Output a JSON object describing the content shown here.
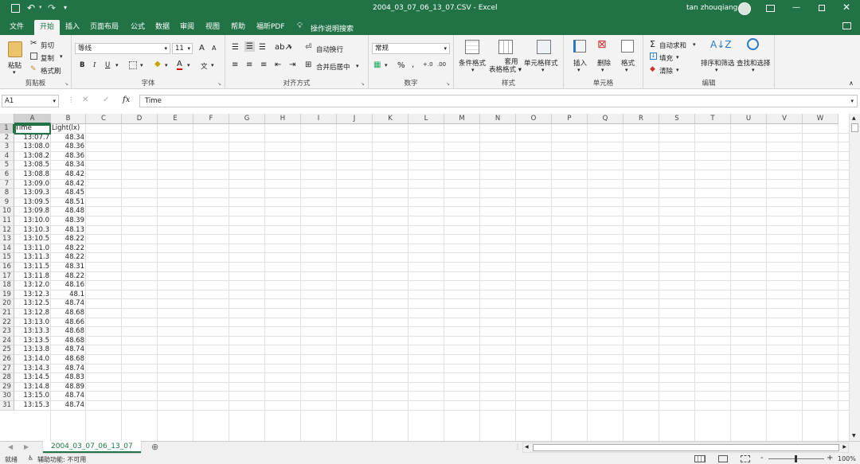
{
  "titlebar": {
    "filename": "2004_03_07_06_13_07.CSV",
    "separator": "-",
    "app": "Excel",
    "user": "tan zhouqiang"
  },
  "tabs": [
    "文件",
    "开始",
    "插入",
    "页面布局",
    "公式",
    "数据",
    "审阅",
    "视图",
    "帮助",
    "福昕PDF"
  ],
  "tell_me": "操作说明搜索",
  "ribbon": {
    "clipboard": {
      "paste": "粘贴",
      "cut": "剪切",
      "copy": "复制",
      "format_painter": "格式刷",
      "label": "剪贴板"
    },
    "font": {
      "name": "等线",
      "size": "11",
      "bold": "B",
      "italic": "I",
      "underline": "U",
      "grow": "A",
      "shrink": "A",
      "label": "字体",
      "font_color_letter": "A",
      "phonetic": "文"
    },
    "alignment": {
      "wrap": "自动换行",
      "merge": "合并后居中",
      "label": "对齐方式"
    },
    "number": {
      "format": "常规",
      "percent": "%",
      "comma": ",",
      "label": "数字"
    },
    "styles": {
      "conditional": "条件格式",
      "table": "套用\n表格格式",
      "cell_styles": "单元格样式",
      "label": "样式"
    },
    "cells": {
      "insert": "插入",
      "delete": "删除",
      "format": "格式",
      "label": "单元格"
    },
    "editing": {
      "autosum": "自动求和",
      "fill": "填充",
      "clear": "清除",
      "sort": "排序和筛选",
      "find": "查找和选择",
      "label": "编辑"
    }
  },
  "formula_bar": {
    "name_box": "A1",
    "fx": "fx",
    "content": "Time"
  },
  "columns": [
    "A",
    "B",
    "C",
    "D",
    "E",
    "F",
    "G",
    "H",
    "I",
    "J",
    "K",
    "L",
    "M",
    "N",
    "O",
    "P",
    "Q",
    "R",
    "S",
    "T",
    "U",
    "V",
    "W"
  ],
  "rows": [
    [
      "Time",
      "Light(lx)"
    ],
    [
      "13:07.7",
      "48.34"
    ],
    [
      "13:08.0",
      "48.36"
    ],
    [
      "13:08.2",
      "48.36"
    ],
    [
      "13:08.5",
      "48.34"
    ],
    [
      "13:08.8",
      "48.42"
    ],
    [
      "13:09.0",
      "48.42"
    ],
    [
      "13:09.3",
      "48.45"
    ],
    [
      "13:09.5",
      "48.51"
    ],
    [
      "13:09.8",
      "48.48"
    ],
    [
      "13:10.0",
      "48.39"
    ],
    [
      "13:10.3",
      "48.13"
    ],
    [
      "13:10.5",
      "48.22"
    ],
    [
      "13:11.0",
      "48.22"
    ],
    [
      "13:11.3",
      "48.22"
    ],
    [
      "13:11.5",
      "48.31"
    ],
    [
      "13:11.8",
      "48.22"
    ],
    [
      "13:12.0",
      "48.16"
    ],
    [
      "13:12.3",
      "48.1"
    ],
    [
      "13:12.5",
      "48.74"
    ],
    [
      "13:12.8",
      "48.68"
    ],
    [
      "13:13.0",
      "48.66"
    ],
    [
      "13:13.3",
      "48.68"
    ],
    [
      "13:13.5",
      "48.68"
    ],
    [
      "13:13.8",
      "48.74"
    ],
    [
      "13:14.0",
      "48.68"
    ],
    [
      "13:14.3",
      "48.74"
    ],
    [
      "13:14.5",
      "48.83"
    ],
    [
      "13:14.8",
      "48.89"
    ],
    [
      "13:15.0",
      "48.74"
    ],
    [
      "13:15.3",
      "48.74"
    ]
  ],
  "sheet": {
    "tab": "2004_03_07_06_13_07",
    "add": "⊕"
  },
  "status": {
    "ready": "就绪",
    "accessibility": "辅助功能: 不可用",
    "zoom": "100%",
    "minus": "-",
    "plus": "+"
  },
  "colors": {
    "accent": "#217346",
    "ribbon_bg": "#f3f3f3",
    "grid_line": "#e1e1e1"
  }
}
